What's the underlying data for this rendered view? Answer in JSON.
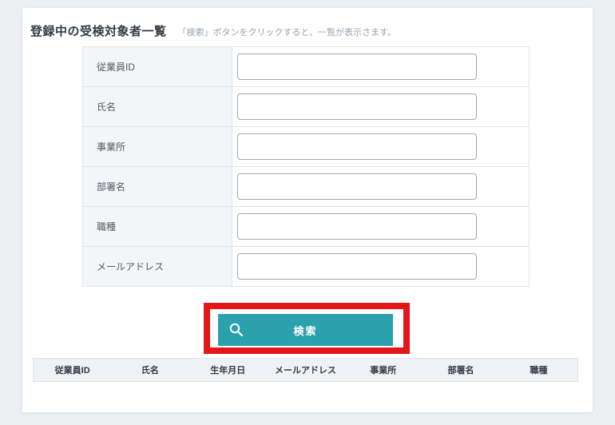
{
  "page": {
    "title": "登録中の受検対象者一覧",
    "subtitle": "「検索」ボタンをクリックすると、一覧が表示さます。"
  },
  "form": {
    "fields": [
      {
        "label": "従業員ID",
        "value": ""
      },
      {
        "label": "氏名",
        "value": ""
      },
      {
        "label": "事業所",
        "value": ""
      },
      {
        "label": "部署名",
        "value": ""
      },
      {
        "label": "職種",
        "value": ""
      },
      {
        "label": "メールアドレス",
        "value": ""
      }
    ]
  },
  "search": {
    "button_label": "検索",
    "icon": "magnifier-icon"
  },
  "results_table": {
    "headers": [
      "従業員ID",
      "氏名",
      "生年月日",
      "メールアドレス",
      "事業所",
      "部署名",
      "職種"
    ],
    "rows": []
  },
  "colors": {
    "accent_teal": "#2ba1ad",
    "highlight_red": "#e31717",
    "page_background": "#edf0f3",
    "label_cell_background": "#f3f6f9",
    "header_row_background": "#eef1f6"
  }
}
